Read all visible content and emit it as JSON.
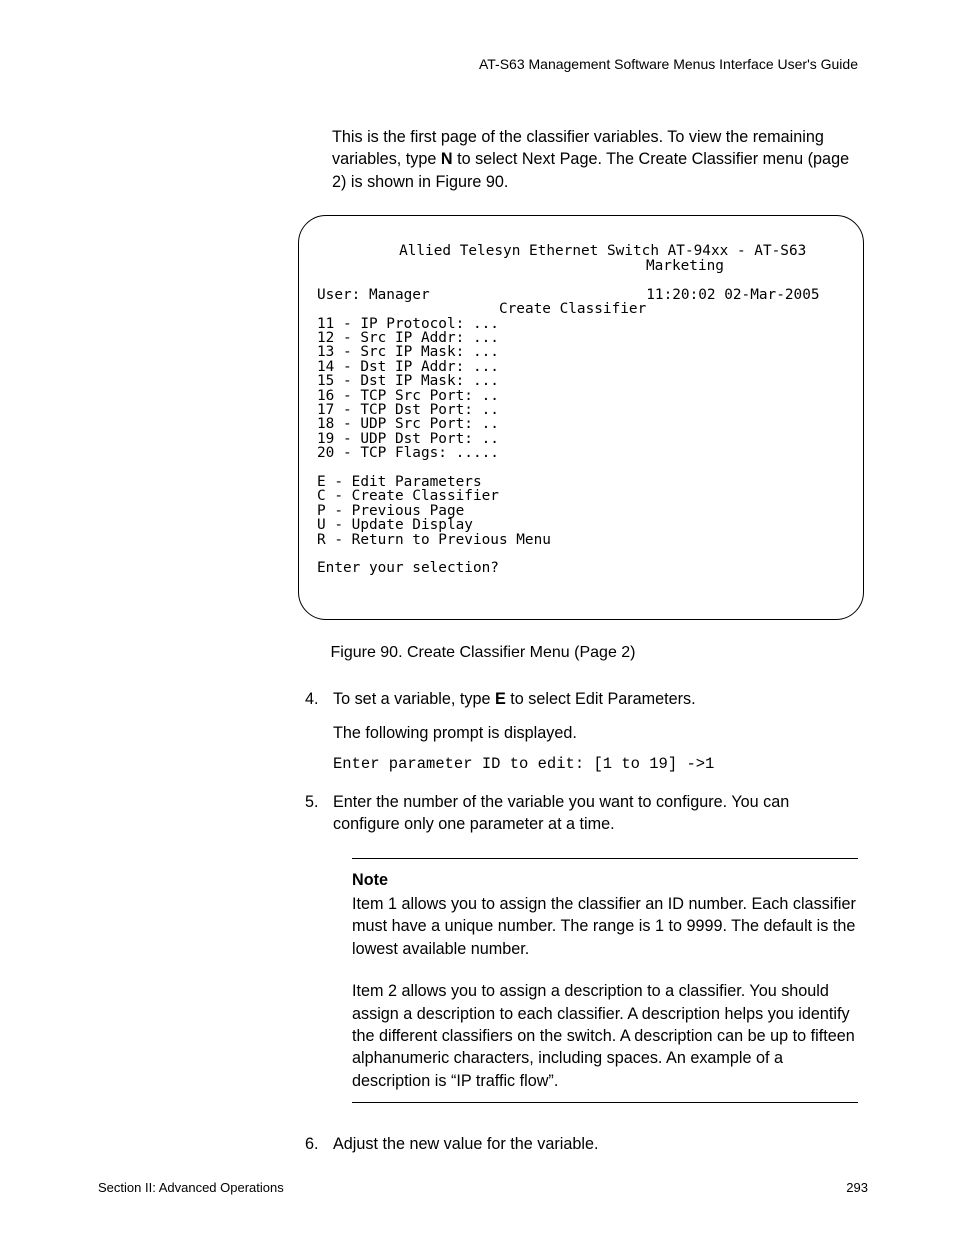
{
  "header": "AT-S63 Management Software Menus Interface User's Guide",
  "intro": {
    "pre": "This is the first page of the classifier variables. To view the remaining variables, type ",
    "key": "N",
    "post": " to select Next Page. The Create Classifier menu (page 2) is shown in Figure 90."
  },
  "terminal": {
    "title1": "Allied Telesyn Ethernet Switch AT-94xx - AT-S63",
    "title2": "Marketing",
    "userline_left": "User: Manager",
    "userline_right": "11:20:02 02-Mar-2005",
    "subtitle": "Create Classifier",
    "rows": [
      "11 - IP Protocol: ...",
      "12 - Src IP Addr: ...",
      "13 - Src IP Mask: ...",
      "14 - Dst IP Addr: ...",
      "15 - Dst IP Mask: ...",
      "16 - TCP Src Port: ..",
      "17 - TCP Dst Port: ..",
      "18 - UDP Src Port: ..",
      "19 - UDP Dst Port: ..",
      "20 - TCP Flags: ....."
    ],
    "cmds": [
      "E - Edit Parameters",
      "C - Create Classifier",
      "P - Previous Page",
      "U - Update Display",
      "R - Return to Previous Menu"
    ],
    "prompt": "Enter your selection?"
  },
  "figure_caption": "Figure 90. Create Classifier Menu (Page 2)",
  "step4": {
    "num": "4.",
    "pre": "To set a variable, type ",
    "key": "E",
    "post": " to select Edit Parameters."
  },
  "step4_sub": "The following prompt is displayed.",
  "step4_mono": "Enter parameter ID to edit: [1 to 19] ->1",
  "step5": {
    "num": "5.",
    "text": "Enter the number of the variable you want to configure. You can configure only one parameter at a time."
  },
  "note": {
    "title": "Note",
    "p1": "Item 1 allows you to assign the classifier an ID number. Each classifier must have a unique number. The range is 1 to 9999. The default is the lowest available number.",
    "p2": "Item 2 allows you to assign a description to a classifier. You should assign a description to each classifier. A description helps you identify the different classifiers on the switch. A description can be up to fifteen alphanumeric characters, including spaces. An example of a description is “IP traffic flow”."
  },
  "step6": {
    "num": "6.",
    "text": "Adjust the new value for the variable."
  },
  "footer": {
    "left": "Section II: Advanced Operations",
    "right": "293"
  }
}
